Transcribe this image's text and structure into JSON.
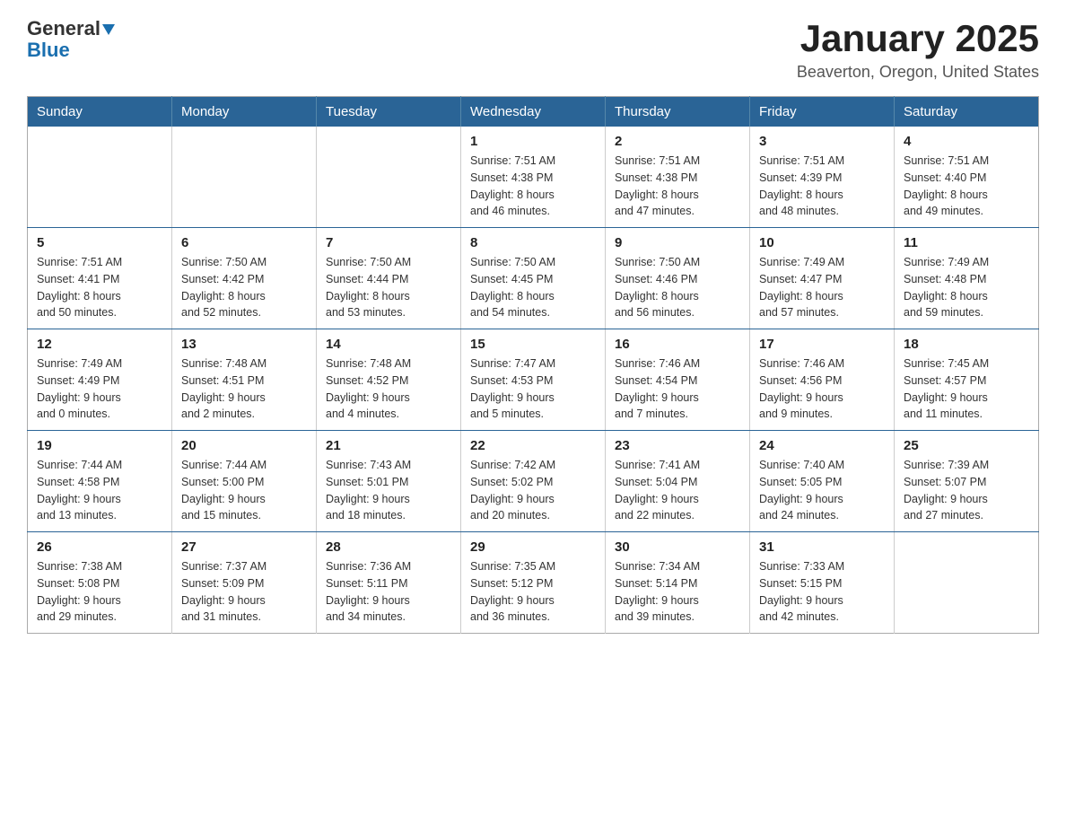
{
  "header": {
    "logo_general": "General",
    "logo_blue": "Blue",
    "month_title": "January 2025",
    "location": "Beaverton, Oregon, United States"
  },
  "calendar": {
    "days_of_week": [
      "Sunday",
      "Monday",
      "Tuesday",
      "Wednesday",
      "Thursday",
      "Friday",
      "Saturday"
    ],
    "weeks": [
      [
        {
          "day": "",
          "info": ""
        },
        {
          "day": "",
          "info": ""
        },
        {
          "day": "",
          "info": ""
        },
        {
          "day": "1",
          "info": "Sunrise: 7:51 AM\nSunset: 4:38 PM\nDaylight: 8 hours\nand 46 minutes."
        },
        {
          "day": "2",
          "info": "Sunrise: 7:51 AM\nSunset: 4:38 PM\nDaylight: 8 hours\nand 47 minutes."
        },
        {
          "day": "3",
          "info": "Sunrise: 7:51 AM\nSunset: 4:39 PM\nDaylight: 8 hours\nand 48 minutes."
        },
        {
          "day": "4",
          "info": "Sunrise: 7:51 AM\nSunset: 4:40 PM\nDaylight: 8 hours\nand 49 minutes."
        }
      ],
      [
        {
          "day": "5",
          "info": "Sunrise: 7:51 AM\nSunset: 4:41 PM\nDaylight: 8 hours\nand 50 minutes."
        },
        {
          "day": "6",
          "info": "Sunrise: 7:50 AM\nSunset: 4:42 PM\nDaylight: 8 hours\nand 52 minutes."
        },
        {
          "day": "7",
          "info": "Sunrise: 7:50 AM\nSunset: 4:44 PM\nDaylight: 8 hours\nand 53 minutes."
        },
        {
          "day": "8",
          "info": "Sunrise: 7:50 AM\nSunset: 4:45 PM\nDaylight: 8 hours\nand 54 minutes."
        },
        {
          "day": "9",
          "info": "Sunrise: 7:50 AM\nSunset: 4:46 PM\nDaylight: 8 hours\nand 56 minutes."
        },
        {
          "day": "10",
          "info": "Sunrise: 7:49 AM\nSunset: 4:47 PM\nDaylight: 8 hours\nand 57 minutes."
        },
        {
          "day": "11",
          "info": "Sunrise: 7:49 AM\nSunset: 4:48 PM\nDaylight: 8 hours\nand 59 minutes."
        }
      ],
      [
        {
          "day": "12",
          "info": "Sunrise: 7:49 AM\nSunset: 4:49 PM\nDaylight: 9 hours\nand 0 minutes."
        },
        {
          "day": "13",
          "info": "Sunrise: 7:48 AM\nSunset: 4:51 PM\nDaylight: 9 hours\nand 2 minutes."
        },
        {
          "day": "14",
          "info": "Sunrise: 7:48 AM\nSunset: 4:52 PM\nDaylight: 9 hours\nand 4 minutes."
        },
        {
          "day": "15",
          "info": "Sunrise: 7:47 AM\nSunset: 4:53 PM\nDaylight: 9 hours\nand 5 minutes."
        },
        {
          "day": "16",
          "info": "Sunrise: 7:46 AM\nSunset: 4:54 PM\nDaylight: 9 hours\nand 7 minutes."
        },
        {
          "day": "17",
          "info": "Sunrise: 7:46 AM\nSunset: 4:56 PM\nDaylight: 9 hours\nand 9 minutes."
        },
        {
          "day": "18",
          "info": "Sunrise: 7:45 AM\nSunset: 4:57 PM\nDaylight: 9 hours\nand 11 minutes."
        }
      ],
      [
        {
          "day": "19",
          "info": "Sunrise: 7:44 AM\nSunset: 4:58 PM\nDaylight: 9 hours\nand 13 minutes."
        },
        {
          "day": "20",
          "info": "Sunrise: 7:44 AM\nSunset: 5:00 PM\nDaylight: 9 hours\nand 15 minutes."
        },
        {
          "day": "21",
          "info": "Sunrise: 7:43 AM\nSunset: 5:01 PM\nDaylight: 9 hours\nand 18 minutes."
        },
        {
          "day": "22",
          "info": "Sunrise: 7:42 AM\nSunset: 5:02 PM\nDaylight: 9 hours\nand 20 minutes."
        },
        {
          "day": "23",
          "info": "Sunrise: 7:41 AM\nSunset: 5:04 PM\nDaylight: 9 hours\nand 22 minutes."
        },
        {
          "day": "24",
          "info": "Sunrise: 7:40 AM\nSunset: 5:05 PM\nDaylight: 9 hours\nand 24 minutes."
        },
        {
          "day": "25",
          "info": "Sunrise: 7:39 AM\nSunset: 5:07 PM\nDaylight: 9 hours\nand 27 minutes."
        }
      ],
      [
        {
          "day": "26",
          "info": "Sunrise: 7:38 AM\nSunset: 5:08 PM\nDaylight: 9 hours\nand 29 minutes."
        },
        {
          "day": "27",
          "info": "Sunrise: 7:37 AM\nSunset: 5:09 PM\nDaylight: 9 hours\nand 31 minutes."
        },
        {
          "day": "28",
          "info": "Sunrise: 7:36 AM\nSunset: 5:11 PM\nDaylight: 9 hours\nand 34 minutes."
        },
        {
          "day": "29",
          "info": "Sunrise: 7:35 AM\nSunset: 5:12 PM\nDaylight: 9 hours\nand 36 minutes."
        },
        {
          "day": "30",
          "info": "Sunrise: 7:34 AM\nSunset: 5:14 PM\nDaylight: 9 hours\nand 39 minutes."
        },
        {
          "day": "31",
          "info": "Sunrise: 7:33 AM\nSunset: 5:15 PM\nDaylight: 9 hours\nand 42 minutes."
        },
        {
          "day": "",
          "info": ""
        }
      ]
    ]
  }
}
